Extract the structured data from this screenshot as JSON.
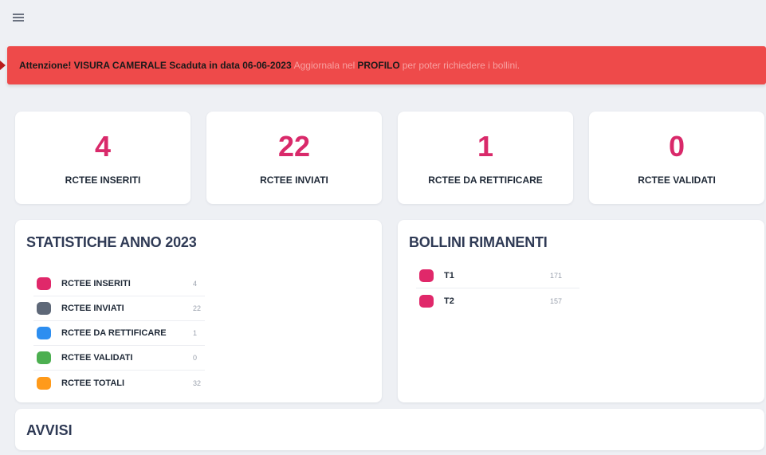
{
  "alert": {
    "prefix": "Attenzione! VISURA CAMERALE Scaduta in data 06-06-2023",
    "middle1": "Aggiornala nel",
    "highlight": "PROFILO",
    "middle2": "per poter richiedere i bollini."
  },
  "stats": [
    {
      "value": "4",
      "label": "RCTEE INSERITI"
    },
    {
      "value": "22",
      "label": "RCTEE INVIATI"
    },
    {
      "value": "1",
      "label": "RCTEE DA RETTIFICARE"
    },
    {
      "value": "0",
      "label": "RCTEE VALIDATI"
    }
  ],
  "statistiche": {
    "title": "STATISTICHE ANNO 2023",
    "rows": [
      {
        "label": "RCTEE INSERITI",
        "value": "4",
        "color": "#e0286a"
      },
      {
        "label": "RCTEE INVIATI",
        "value": "22",
        "color": "#5e6878"
      },
      {
        "label": "RCTEE DA RETTIFICARE",
        "value": "1",
        "color": "#2d8ef0"
      },
      {
        "label": "RCTEE VALIDATI",
        "value": "0",
        "color": "#4caf50"
      },
      {
        "label": "RCTEE TOTALI",
        "value": "32",
        "color": "#ff9a1a"
      }
    ]
  },
  "bollini": {
    "title": "BOLLINI RIMANENTI",
    "rows": [
      {
        "label": "T1",
        "value": "171",
        "color": "#e0286a"
      },
      {
        "label": "T2",
        "value": "157",
        "color": "#e0286a"
      }
    ]
  },
  "avvisi": {
    "title": "AVVISI"
  },
  "icons": {
    "menu": "hamburger-menu-icon"
  }
}
